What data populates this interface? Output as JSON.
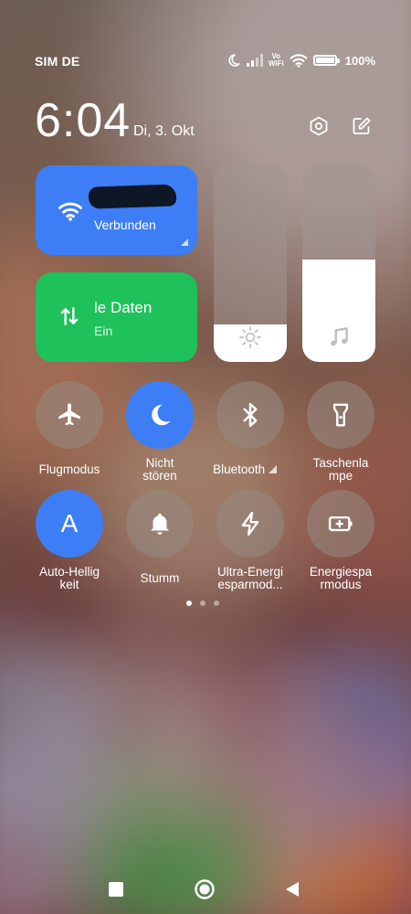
{
  "status_bar": {
    "carrier": "SIM DE",
    "icons": [
      "moon-icon",
      "signal-icon",
      "vowifi-icon",
      "wifi-icon",
      "battery-icon"
    ],
    "vowifi_top": "Vo",
    "vowifi_bottom": "WiFi",
    "battery_percent": "100%"
  },
  "header": {
    "time": "6:04",
    "date": "Di, 3. Okt",
    "settings_icon": "settings-hexagon-icon",
    "edit_icon": "edit-icon"
  },
  "tiles": {
    "wifi": {
      "subtitle": "Verbunden",
      "state": "on",
      "color": "#3d7ef6"
    },
    "mobile_data": {
      "title": "le Daten",
      "subtitle": "Ein",
      "state": "on",
      "color": "#1fc15b"
    }
  },
  "sliders": {
    "brightness": {
      "icon": "sun-icon",
      "level": 0.19
    },
    "volume": {
      "icon": "music-note-icon",
      "level": 0.52
    }
  },
  "toggles": [
    {
      "label": "Flugmodus",
      "icon": "airplane-icon",
      "on": false
    },
    {
      "label": "Nicht\nstören",
      "icon": "moon-icon",
      "on": true
    },
    {
      "label": "Bluetooth",
      "icon": "bluetooth-icon",
      "on": false
    },
    {
      "label": "Taschenla\nmpe",
      "icon": "flashlight-icon",
      "on": false
    },
    {
      "label": "Auto-Hellig\nkeit",
      "icon": "auto-brightness-icon",
      "on": true
    },
    {
      "label": "Stumm",
      "icon": "bell-icon",
      "on": false
    },
    {
      "label": "Ultra-Energi\nesparmod...",
      "icon": "lightning-icon",
      "on": false
    },
    {
      "label": "Energiespa\nrmodus",
      "icon": "battery-saver-icon",
      "on": false
    }
  ],
  "auto_glyph": "A",
  "pager": {
    "pages": 3,
    "current": 1
  },
  "nav": [
    "recents-button",
    "home-button",
    "back-button"
  ],
  "accent": "#3d7ef6"
}
